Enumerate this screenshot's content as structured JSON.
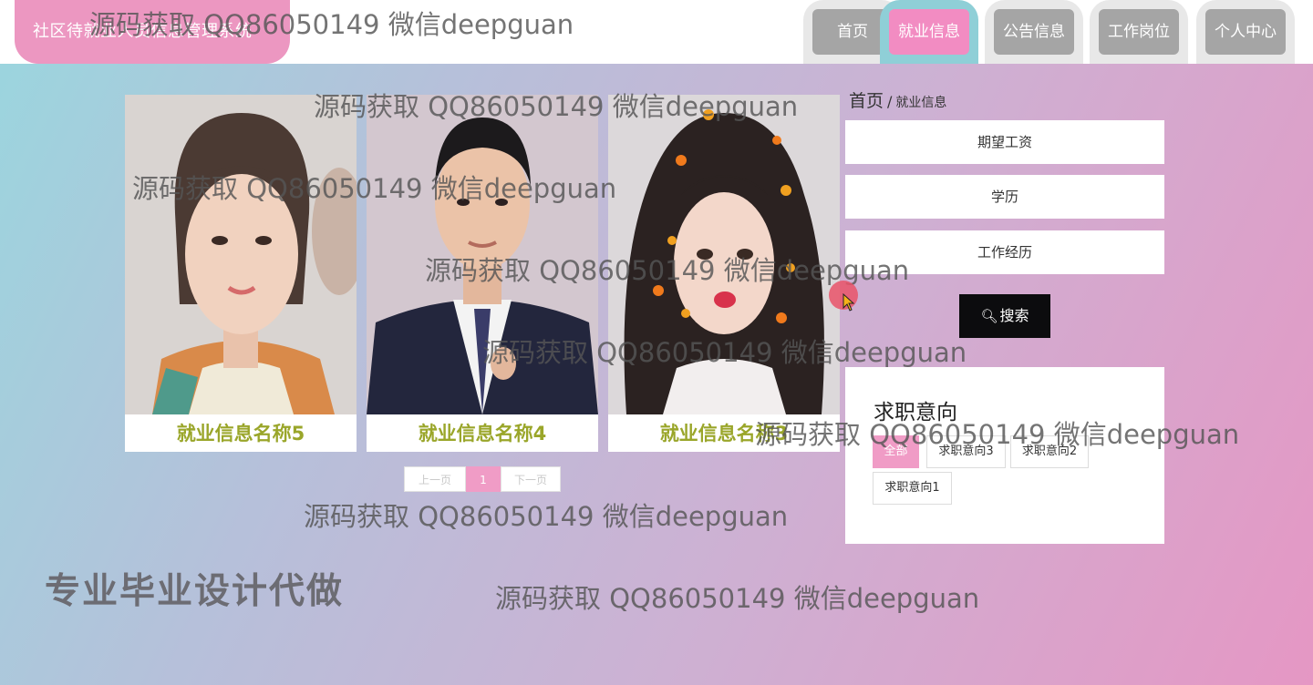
{
  "header": {
    "logo_text": "社区待就业人员信息管理系统",
    "nav": [
      {
        "label": "首页",
        "active": false
      },
      {
        "label": "就业信息",
        "active": true
      },
      {
        "label": "公告信息",
        "active": false
      },
      {
        "label": "工作岗位",
        "active": false
      },
      {
        "label": "个人中心",
        "active": false
      }
    ]
  },
  "cards": [
    {
      "title": "就业信息名称5",
      "photo": "portrait-young-woman-smiling"
    },
    {
      "title": "就业信息名称4",
      "photo": "portrait-man-in-suit"
    },
    {
      "title": "就业信息名称3",
      "photo": "portrait-woman-with-flowers"
    }
  ],
  "pagination": {
    "prev": "上一页",
    "current": "1",
    "next": "下一页"
  },
  "breadcrumb": {
    "home": "首页",
    "separator": "/",
    "current": "就业信息"
  },
  "search": {
    "fields": [
      "期望工资",
      "学历",
      "工作经历"
    ],
    "button_label": "搜索",
    "button_icon": "search-icon"
  },
  "intent": {
    "title": "求职意向",
    "chips": [
      {
        "label": "全部",
        "active": true
      },
      {
        "label": "求职意向3",
        "active": false
      },
      {
        "label": "求职意向2",
        "active": false
      },
      {
        "label": "求职意向1",
        "active": false
      }
    ]
  },
  "promo_text": "专业毕业设计代做",
  "watermark": "源码获取 QQ86050149 微信deepguan",
  "colors": {
    "accent_pink": "#f28cc2",
    "active_tab_frame": "#8fcfd7",
    "inactive_tab": "#a5a5a5",
    "card_title": "#9aa62a",
    "search_button": "#0c0c0e"
  }
}
